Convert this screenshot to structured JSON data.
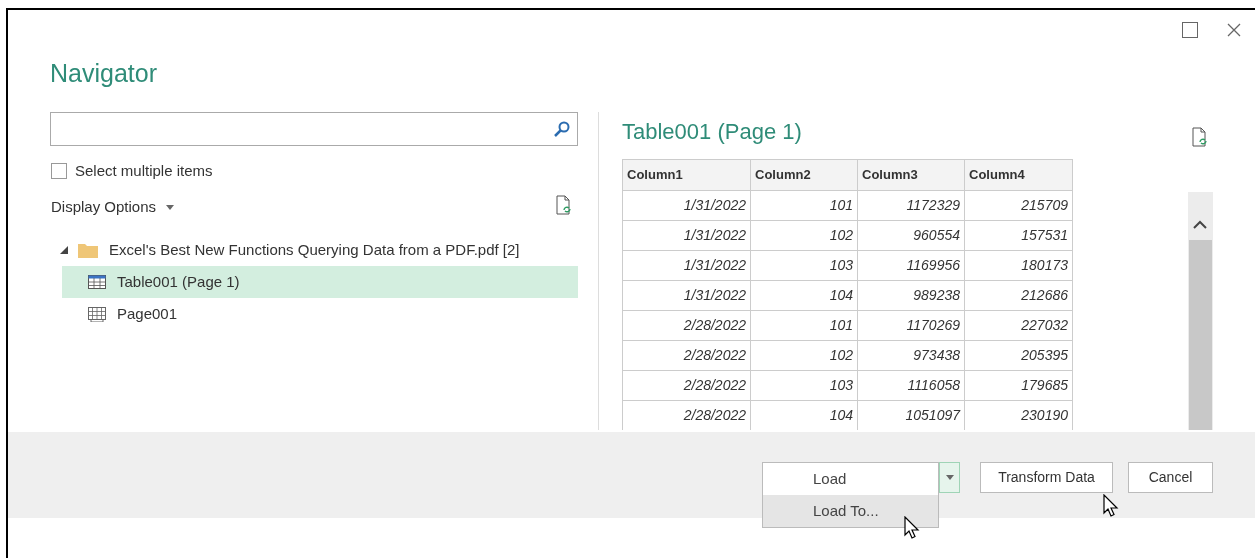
{
  "window": {
    "title": "Navigator"
  },
  "select_multiple": {
    "label": "Select multiple items",
    "checked": false
  },
  "display_options": {
    "label": "Display Options"
  },
  "tree": [
    {
      "label": "Excel's Best New Functions Querying Data from a PDF.pdf [2]",
      "kind": "folder",
      "expanded": true,
      "selected": false,
      "children": [
        {
          "label": "Table001 (Page 1)",
          "kind": "table",
          "selected": true
        },
        {
          "label": "Page001",
          "kind": "page",
          "selected": false
        }
      ]
    }
  ],
  "preview": {
    "title": "Table001 (Page 1)",
    "table": {
      "columns": [
        "Column1",
        "Column2",
        "Column3",
        "Column4"
      ],
      "rows": [
        [
          "1/31/2022",
          "101",
          "1172329",
          "215709"
        ],
        [
          "1/31/2022",
          "102",
          "960554",
          "157531"
        ],
        [
          "1/31/2022",
          "103",
          "1169956",
          "180173"
        ],
        [
          "1/31/2022",
          "104",
          "989238",
          "212686"
        ],
        [
          "2/28/2022",
          "101",
          "1170269",
          "227032"
        ],
        [
          "2/28/2022",
          "102",
          "973438",
          "205395"
        ],
        [
          "2/28/2022",
          "103",
          "1116058",
          "179685"
        ],
        [
          "2/28/2022",
          "104",
          "1051097",
          "230190"
        ]
      ]
    }
  },
  "load_menu": [
    {
      "label": "Load",
      "selected": false
    },
    {
      "label": "Load To...",
      "selected": true
    }
  ],
  "buttons": [
    "Transform Data",
    "Cancel"
  ]
}
